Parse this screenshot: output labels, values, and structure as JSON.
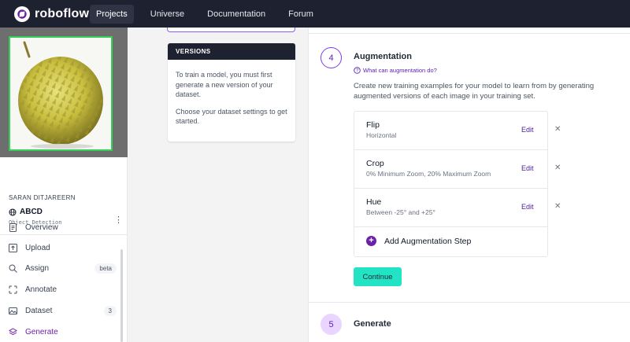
{
  "brand": {
    "name": "roboflow"
  },
  "nav": {
    "items": [
      "Projects",
      "Universe",
      "Documentation",
      "Forum"
    ],
    "active": "Projects"
  },
  "sidebar": {
    "owner": "SARAN DITJAREERN",
    "project_name": "ABCD",
    "project_type": "Object Detection",
    "menu": [
      {
        "label": "Overview",
        "icon": "document-icon"
      },
      {
        "label": "Upload",
        "icon": "upload-icon"
      },
      {
        "label": "Assign",
        "icon": "search-icon",
        "badge": "beta"
      },
      {
        "label": "Annotate",
        "icon": "annotate-icon"
      },
      {
        "label": "Dataset",
        "icon": "images-icon",
        "badge": "3"
      },
      {
        "label": "Generate",
        "icon": "stack-icon",
        "active": true
      }
    ]
  },
  "versions": {
    "header": "VERSIONS",
    "text1": "To train a model, you must first generate a new version of your dataset.",
    "text2": "Choose your dataset settings to get started."
  },
  "step4": {
    "number": "4",
    "title": "Augmentation",
    "help_link": "What can augmentation do?",
    "description": "Create new training examples for your model to learn from by generating augmented versions of each image in your training set.",
    "augmentations": [
      {
        "name": "Flip",
        "detail": "Horizontal",
        "edit": "Edit"
      },
      {
        "name": "Crop",
        "detail": "0% Minimum Zoom, 20% Maximum Zoom",
        "edit": "Edit"
      },
      {
        "name": "Hue",
        "detail": "Between -25° and +25°",
        "edit": "Edit"
      }
    ],
    "add_step": "Add Augmentation Step",
    "continue": "Continue"
  },
  "step5": {
    "number": "5",
    "title": "Generate"
  },
  "colors": {
    "accent": "#6b21a8",
    "continue": "#22e4c4",
    "nav_bg": "#1e2130"
  }
}
